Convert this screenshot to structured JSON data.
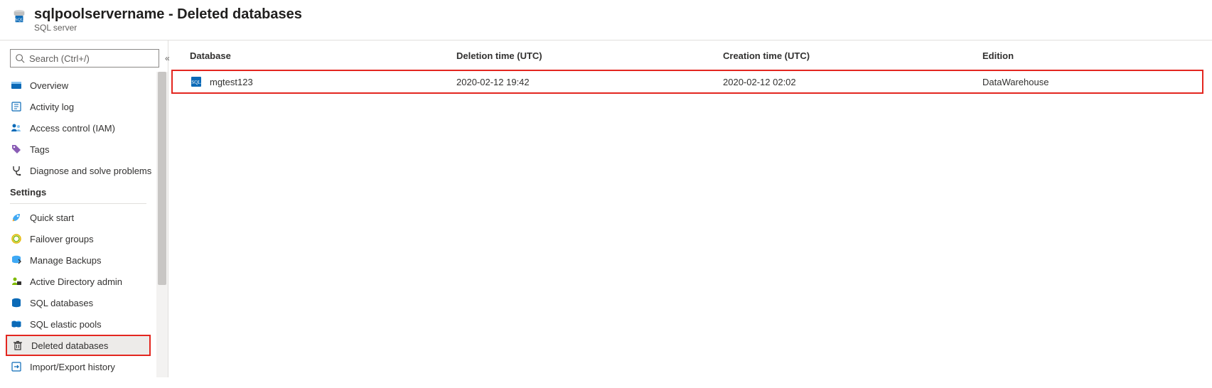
{
  "header": {
    "title": "sqlpoolservername - Deleted databases",
    "subtitle": "SQL server"
  },
  "sidebar": {
    "search_placeholder": "Search (Ctrl+/)",
    "items_top": [
      {
        "label": "Overview",
        "icon": "overview-icon"
      },
      {
        "label": "Activity log",
        "icon": "activity-log-icon"
      },
      {
        "label": "Access control (IAM)",
        "icon": "access-control-icon"
      },
      {
        "label": "Tags",
        "icon": "tags-icon"
      },
      {
        "label": "Diagnose and solve problems",
        "icon": "diagnose-icon"
      }
    ],
    "section_settings": "Settings",
    "items_settings": [
      {
        "label": "Quick start",
        "icon": "quick-start-icon"
      },
      {
        "label": "Failover groups",
        "icon": "failover-groups-icon"
      },
      {
        "label": "Manage Backups",
        "icon": "manage-backups-icon"
      },
      {
        "label": "Active Directory admin",
        "icon": "aad-admin-icon"
      },
      {
        "label": "SQL databases",
        "icon": "sql-databases-icon"
      },
      {
        "label": "SQL elastic pools",
        "icon": "sql-elastic-pools-icon"
      },
      {
        "label": "Deleted databases",
        "icon": "deleted-databases-icon",
        "selected": true,
        "highlight": true
      },
      {
        "label": "Import/Export history",
        "icon": "import-export-icon"
      }
    ]
  },
  "table": {
    "columns": {
      "database": "Database",
      "deletion": "Deletion time (UTC)",
      "creation": "Creation time (UTC)",
      "edition": "Edition"
    },
    "rows": [
      {
        "database": "mgtest123",
        "deletion": "2020-02-12 19:42",
        "creation": "2020-02-12 02:02",
        "edition": "DataWarehouse",
        "highlight": true
      }
    ]
  }
}
